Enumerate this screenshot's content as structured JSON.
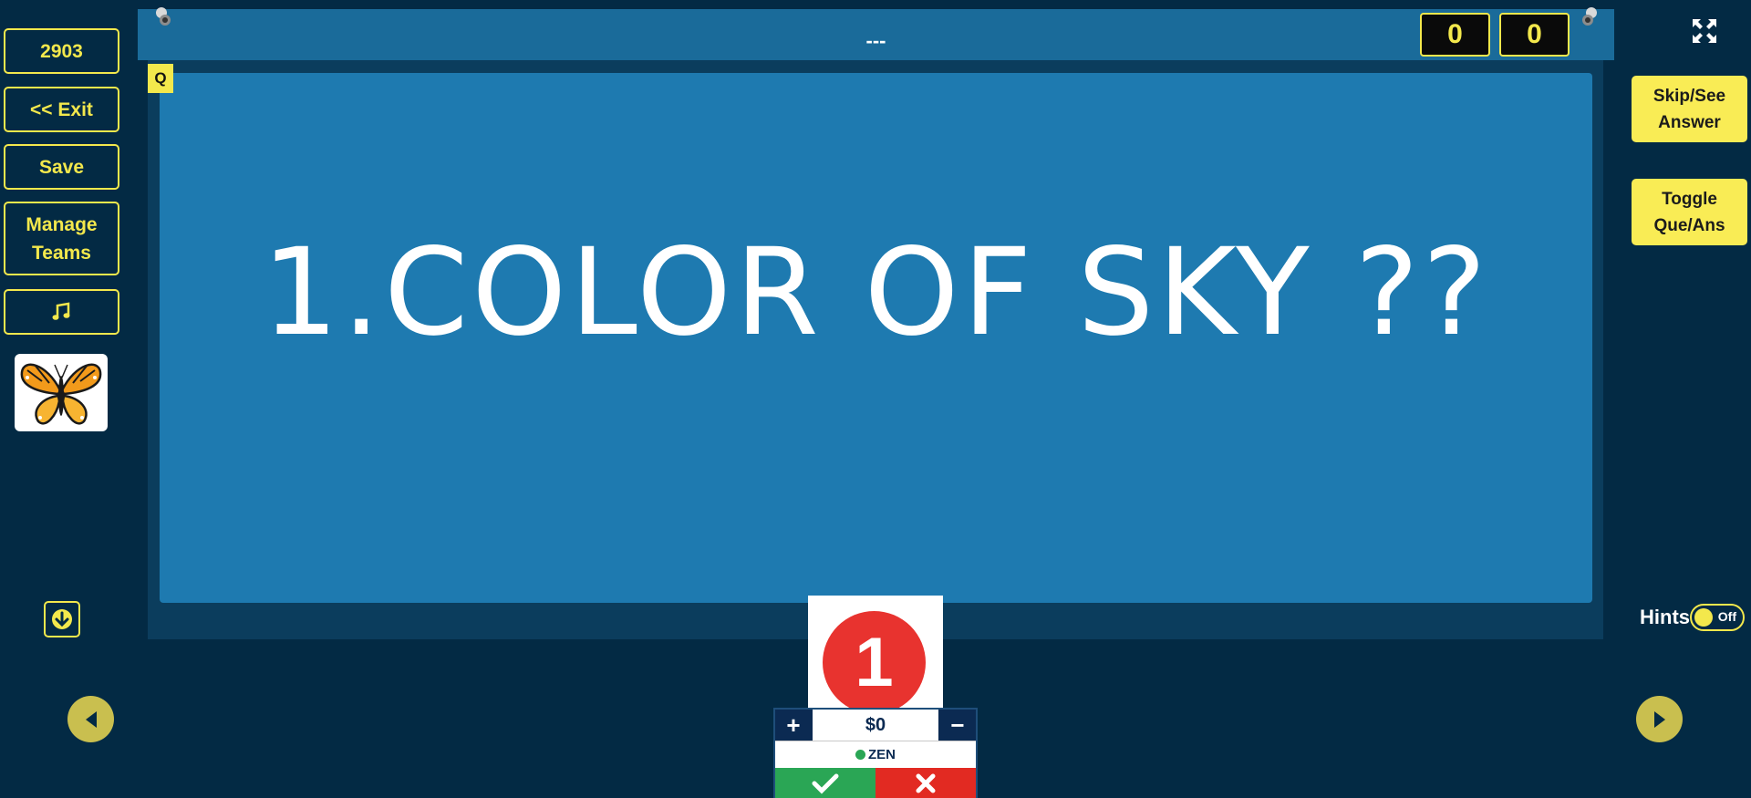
{
  "sidebar": {
    "game_code": "2903",
    "exit_label": "<< Exit",
    "save_label": "Save",
    "manage_teams_line1": "Manage",
    "manage_teams_line2": "Teams",
    "music_icon": "music-note-icon",
    "avatar": "butterfly",
    "scroll_down_icon": "arrow-down-icon"
  },
  "header": {
    "title": "---",
    "scores": [
      "0",
      "0"
    ]
  },
  "board": {
    "tag": "Q",
    "question": "1.COLOR OF SKY ??"
  },
  "right_panel": {
    "skip_line1": "Skip/See",
    "skip_line2": "Answer",
    "toggle_line1": "Toggle",
    "toggle_line2": "Que/Ans",
    "hints_label": "Hints",
    "hints_state": "Off"
  },
  "team": {
    "number": "1",
    "money": "$0",
    "name": "ZEN",
    "plus": "+",
    "minus": "−"
  },
  "colors": {
    "background": "#032a44",
    "board": "#1e7ab0",
    "accent": "#f3e84c",
    "badge": "#e8332f",
    "correct": "#2aa655",
    "wrong": "#e22a22"
  }
}
